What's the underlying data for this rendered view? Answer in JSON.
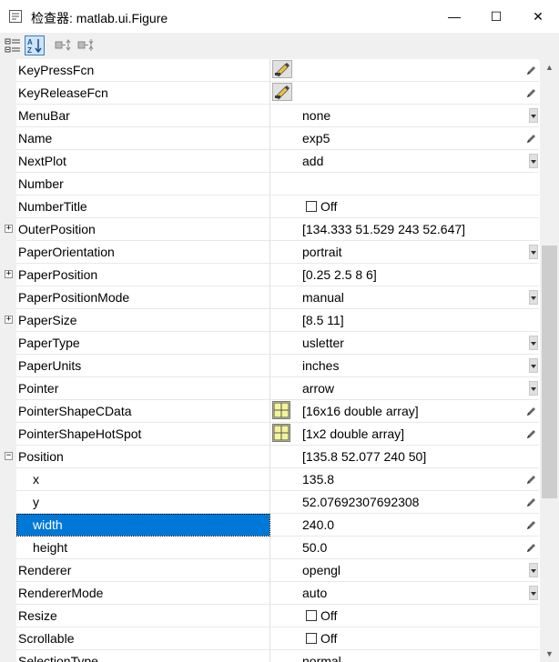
{
  "window": {
    "title": "检查器:  matlab.ui.Figure",
    "minimize_label": "—",
    "maximize_label": "☐",
    "close_label": "✕"
  },
  "toolbar": {
    "buttons": [
      {
        "name": "categorize-icon",
        "active": false
      },
      {
        "name": "sort-alphabetical-icon",
        "active": true
      },
      {
        "name": "expand-all-icon",
        "active": false
      },
      {
        "name": "collapse-all-icon",
        "active": false
      }
    ]
  },
  "properties": [
    {
      "name": "KeyPressFcn",
      "value": "",
      "editor": "edit",
      "control": "pencil"
    },
    {
      "name": "KeyReleaseFcn",
      "value": "",
      "editor": "edit",
      "control": "pencil"
    },
    {
      "name": "MenuBar",
      "value": "none",
      "control": "dropdown"
    },
    {
      "name": "Name",
      "value": "exp5",
      "control": "pencil"
    },
    {
      "name": "NextPlot",
      "value": "add",
      "control": "dropdown"
    },
    {
      "name": "Number",
      "value": ""
    },
    {
      "name": "NumberTitle",
      "value": "",
      "checkbox": true,
      "checkbox_label": "Off"
    },
    {
      "name": "OuterPosition",
      "value": "[134.333 51.529 243 52.647]",
      "expander": "+"
    },
    {
      "name": "PaperOrientation",
      "value": "portrait",
      "control": "dropdown"
    },
    {
      "name": "PaperPosition",
      "value": "[0.25 2.5 8 6]",
      "expander": "+"
    },
    {
      "name": "PaperPositionMode",
      "value": "manual",
      "control": "dropdown"
    },
    {
      "name": "PaperSize",
      "value": "[8.5 11]",
      "expander": "+"
    },
    {
      "name": "PaperType",
      "value": "usletter",
      "control": "dropdown"
    },
    {
      "name": "PaperUnits",
      "value": "inches",
      "control": "dropdown"
    },
    {
      "name": "Pointer",
      "value": "arrow",
      "control": "dropdown"
    },
    {
      "name": "PointerShapeCData",
      "value": "[16x16  double array]",
      "editor": "grid",
      "control": "pencil"
    },
    {
      "name": "PointerShapeHotSpot",
      "value": "[1x2  double array]",
      "editor": "grid",
      "control": "pencil"
    },
    {
      "name": "Position",
      "value": "[135.8 52.077 240 50]",
      "expander": "−"
    },
    {
      "name": "x",
      "value": "135.8",
      "indent": true,
      "control": "pencil"
    },
    {
      "name": "y",
      "value": "52.07692307692308",
      "indent": true,
      "control": "pencil"
    },
    {
      "name": "width",
      "value": "240.0",
      "indent": true,
      "selected": true,
      "control": "pencil"
    },
    {
      "name": "height",
      "value": "50.0",
      "indent": true,
      "control": "pencil"
    },
    {
      "name": "Renderer",
      "value": "opengl",
      "control": "dropdown"
    },
    {
      "name": "RendererMode",
      "value": "auto",
      "control": "dropdown"
    },
    {
      "name": "Resize",
      "value": "",
      "checkbox": true,
      "checkbox_label": "Off"
    },
    {
      "name": "Scrollable",
      "value": "",
      "checkbox": true,
      "checkbox_label": "Off"
    },
    {
      "name": "SelectionType",
      "value": "normal"
    }
  ],
  "scrollbar": {
    "up_label": "▲",
    "down_label": "▼"
  },
  "colors": {
    "selection": "#0078d7",
    "toolbar_bg": "#f0f0f0"
  }
}
